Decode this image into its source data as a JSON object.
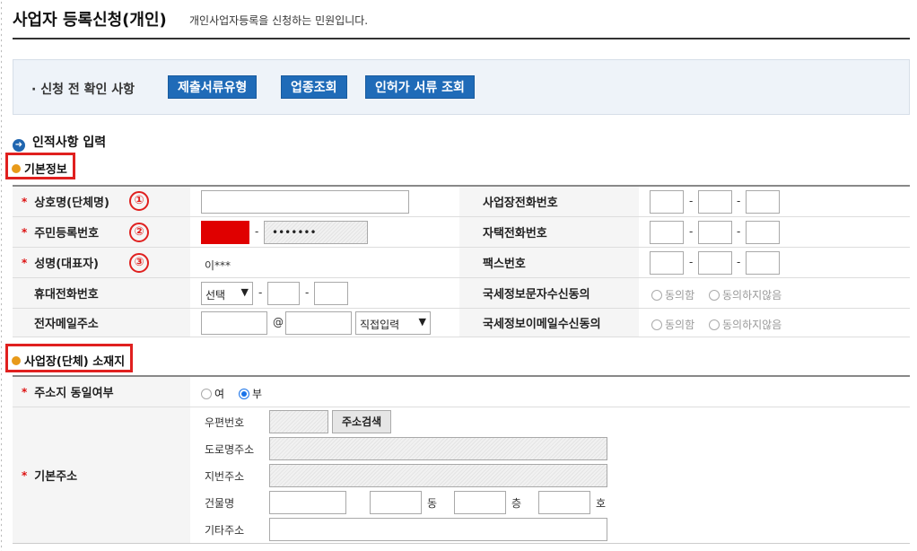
{
  "header": {
    "title": "사업자 등록신청(개인)",
    "description": "개인사업자등록을 신청하는 민원입니다."
  },
  "precheck": {
    "label": "· 신청 전 확인 사항",
    "buttons": [
      "제출서류유형",
      "업종조회",
      "인허가 서류 조회"
    ]
  },
  "section": {
    "title": "인적사항 입력",
    "basic_info_title": "기본정보",
    "address_title": "사업장(단체) 소재지"
  },
  "basic_info": {
    "trade_name_label": "상호명(단체명)",
    "resident_no_label": "주민등록번호",
    "resident_no_masked": "•••••••",
    "name_label": "성명(대표자)",
    "name_value": "이***",
    "mobile_label": "휴대전화번호",
    "mobile_select": "선택",
    "email_label": "전자메일주소",
    "email_at": "@",
    "email_domain_select": "직접입력",
    "business_phone_label": "사업장전화번호",
    "home_phone_label": "자택전화번호",
    "fax_label": "팩스번호",
    "sms_consent_label": "국세정보문자수신동의",
    "email_consent_label": "국세정보이메일수신동의",
    "agree": "동의함",
    "disagree": "동의하지않음",
    "dash": "-",
    "markers": [
      "①",
      "②",
      "③"
    ]
  },
  "address": {
    "same_address_label": "주소지 동일여부",
    "yes": "여",
    "no": "부",
    "selected": "부",
    "base_address_label": "기본주소",
    "postal_code_label": "우편번호",
    "search_button": "주소검색",
    "road_address_label": "도로명주소",
    "lot_address_label": "지번주소",
    "building_label": "건물명",
    "dong": "동",
    "floor": "층",
    "ho": "호",
    "other_address_label": "기타주소"
  },
  "colors": {
    "primary_button": "#1f6bb8",
    "highlight_red": "#e0201f",
    "required_star": "#d11111",
    "bullet_orange": "#e89a1a"
  }
}
